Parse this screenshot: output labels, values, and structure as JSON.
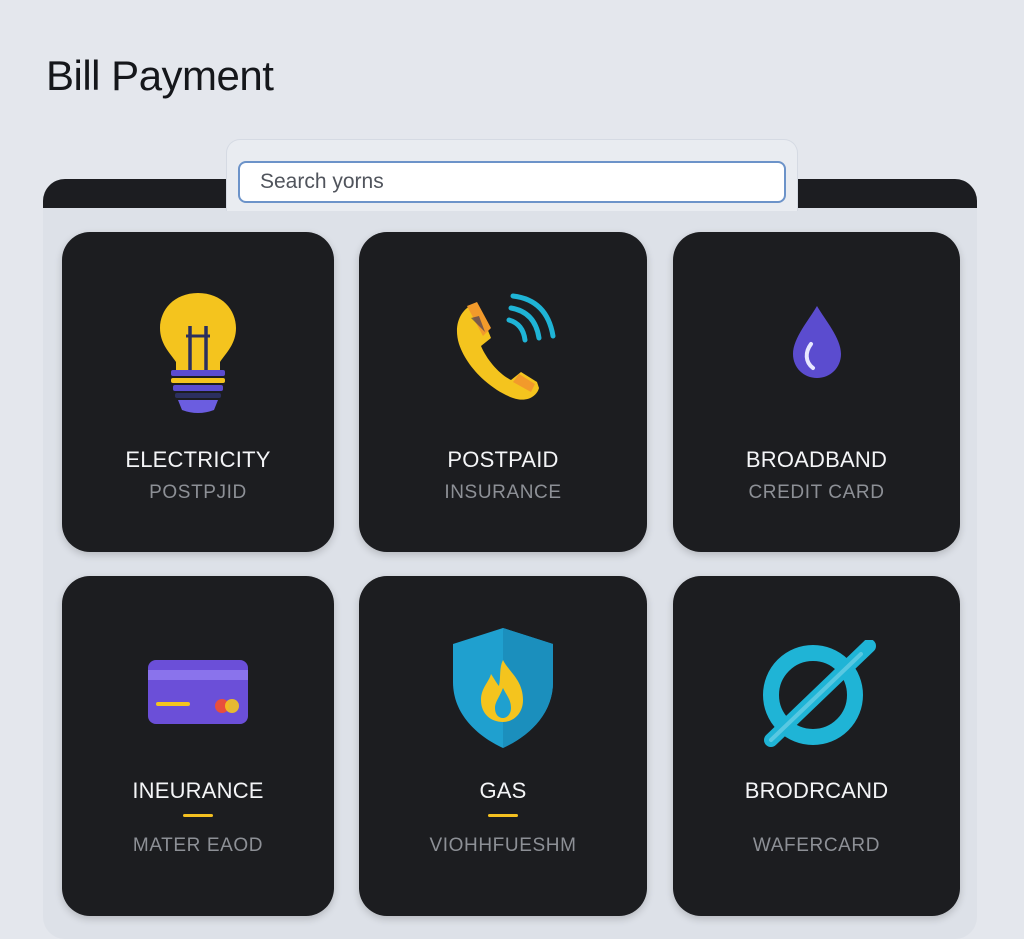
{
  "header": {
    "title": "Bill Payment"
  },
  "search": {
    "placeholder": "Search yorns"
  },
  "colors": {
    "background": "#e4e7ed",
    "card": "#1c1d20",
    "accent_yellow": "#f4c020",
    "accent_cyan": "#1fb4d6",
    "accent_purple": "#5b4ccf",
    "search_border": "#6c93c9"
  },
  "cards": [
    {
      "title": "ELECTRICITY",
      "subtitle": "POSTPJID",
      "icon": "lightbulb-icon"
    },
    {
      "title": "POSTPAID",
      "subtitle": "INSURANCE",
      "icon": "phone-signal-icon"
    },
    {
      "title": "BROADBAND",
      "subtitle": "CREDIT CARD",
      "icon": "water-drop-icon"
    },
    {
      "title": "INEURANCE",
      "subtitle": "MATER EAOD",
      "icon": "credit-card-icon"
    },
    {
      "title": "GAS",
      "subtitle": "VIOHHFUESHM",
      "icon": "shield-flame-icon"
    },
    {
      "title": "BRODRCAND",
      "subtitle": "WAFERCARD",
      "icon": "no-signal-icon"
    }
  ]
}
